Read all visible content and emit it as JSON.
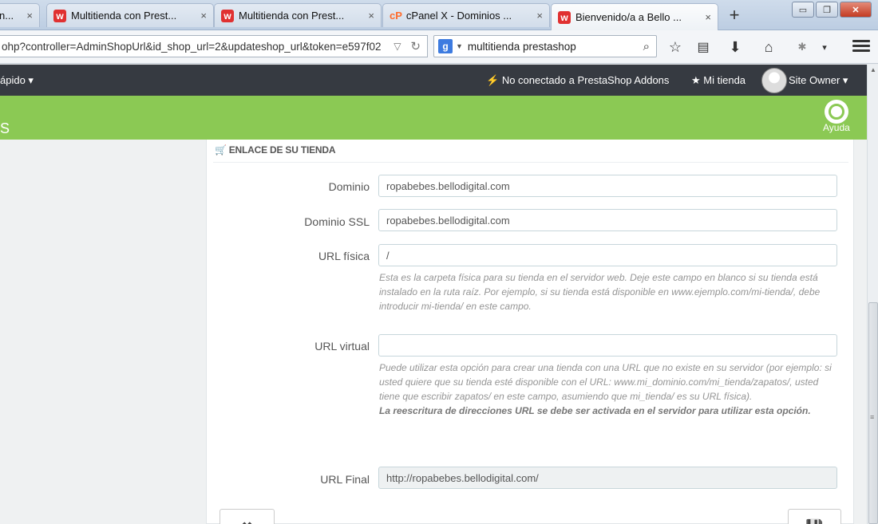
{
  "browser": {
    "tabs": [
      {
        "title": "n...",
        "favicon": "w",
        "close": "×"
      },
      {
        "title": "Multitienda con Prest...",
        "favicon": "w",
        "close": "×"
      },
      {
        "title": "Multitienda con Prest...",
        "favicon": "w",
        "close": "×"
      },
      {
        "title": "cPanel X - Dominios ...",
        "favicon": "cP",
        "close": "×"
      },
      {
        "title": "Bienvenido/a a Bello ...",
        "favicon": "w",
        "close": "×"
      }
    ],
    "new_tab": "+",
    "url": "ohp?controller=AdminShopUrl&id_shop_url=2&updateshop_url&token=e597f02",
    "search_engine": "g",
    "search_query": "multitienda prestashop",
    "window_buttons": {
      "minimize": "▭",
      "maximize": "❐",
      "close": "✕"
    }
  },
  "admin_header": {
    "quick_access": "ápido ▾",
    "addons_status": "No conectado a PrestaShop Addons",
    "my_shop": "Mi tienda",
    "user": "Site Owner ▾"
  },
  "toolbar": {
    "title_fragment": "S",
    "help_label": "Ayuda"
  },
  "panel": {
    "heading": "ENLACE DE SU TIENDA",
    "fields": {
      "dominio": {
        "label": "Dominio",
        "value": "ropabebes.bellodigital.com"
      },
      "dominio_ssl": {
        "label": "Dominio SSL",
        "value": "ropabebes.bellodigital.com"
      },
      "url_fisica": {
        "label": "URL física",
        "value": "/",
        "help": "Esta es la carpeta física para su tienda en el servidor web. Deje este campo en blanco si su tienda está instalado en la ruta raíz. Por ejemplo, si su tienda está disponible en www.ejemplo.com/mi-tienda/, debe introducir mi-tienda/ en este campo."
      },
      "url_virtual": {
        "label": "URL virtual",
        "value": "",
        "help": "Puede utilizar esta opción para crear una tienda con una URL que no existe en su servidor (por ejemplo: si usted quiere que su tienda esté disponible con el URL: www.mi_dominio.com/mi_tienda/zapatos/, usted tiene que escribir zapatos/ en este campo, asumiendo que mi_tienda/ es su URL física).",
        "help_bold": "La reescritura de direcciones URL se debe ser activada en el servidor para utilizar esta opción."
      },
      "url_final": {
        "label": "URL Final",
        "value": "http://ropabebes.bellodigital.com/"
      }
    }
  },
  "icons": {
    "cart": "shopping-cart-icon",
    "help": "lifebuoy-icon",
    "star": "star-icon",
    "plug": "plug-icon",
    "cancel": "close-icon",
    "save": "save-icon"
  }
}
